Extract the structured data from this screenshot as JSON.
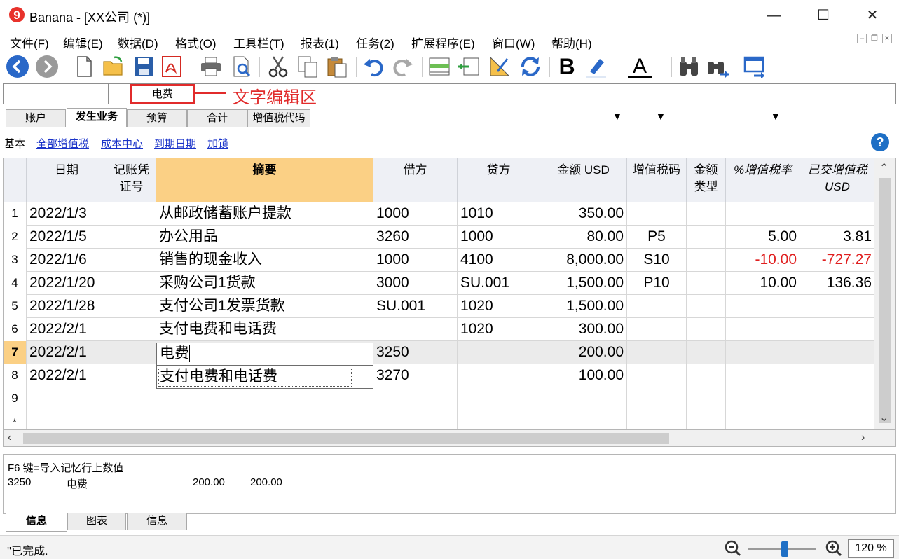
{
  "window": {
    "title": "Banana - [XX公司 (*)]"
  },
  "menu": [
    "文件(F)",
    "编辑(E)",
    "数据(D)",
    "格式(O)",
    "工具栏(T)",
    "报表(1)",
    "任务(2)",
    "扩展程序(E)",
    "窗口(W)",
    "帮助(H)"
  ],
  "toolbar": {
    "icons": [
      "back-icon",
      "forward-icon",
      "new-file-icon",
      "open-folder-icon",
      "save-icon",
      "pdf-icon",
      "print-icon",
      "print-preview-icon",
      "cut-icon",
      "copy-icon",
      "paste-icon",
      "undo-icon",
      "redo-icon",
      "insert-row-icon",
      "move-row-icon",
      "edit-tool-icon",
      "recalculate-icon",
      "bold-icon",
      "highlight-icon",
      "font-color-icon",
      "find-icon",
      "find-replace-icon",
      "window-icon"
    ],
    "bold_label": "B",
    "font_color_label": "A"
  },
  "editbar": {
    "value": "电费",
    "annotation": "文字编辑区"
  },
  "tabs": [
    "账户",
    "发生业务",
    "预算",
    "合计",
    "增值税代码"
  ],
  "active_tab": "发生业务",
  "views": {
    "base": "基本",
    "links": [
      "全部增值税",
      "成本中心",
      "到期日期",
      "加锁"
    ]
  },
  "help": "?",
  "columns": [
    "日期",
    "记账凭证号",
    "摘要",
    "借方",
    "贷方",
    "金额 USD",
    "增值税码",
    "金额类型",
    "%增值税率",
    "已交增值税 USD"
  ],
  "column_header_lines": {
    "voucher": [
      "记账凭",
      "证号"
    ],
    "amount_type": [
      "金额",
      "类型"
    ],
    "vat_paid": [
      "已交增值税",
      "USD"
    ]
  },
  "rows": [
    {
      "n": "1",
      "date": "2022/1/3",
      "doc": "",
      "desc": "从邮政储蓄账户提款",
      "debit": "1000",
      "credit": "1010",
      "amount": "350.00",
      "vat": "",
      "type": "",
      "rate": "",
      "paid": ""
    },
    {
      "n": "2",
      "date": "2022/1/5",
      "doc": "",
      "desc": "办公用品",
      "debit": "3260",
      "credit": "1000",
      "amount": "80.00",
      "vat": "P5",
      "type": "",
      "rate": "5.00",
      "paid": "3.81"
    },
    {
      "n": "3",
      "date": "2022/1/6",
      "doc": "",
      "desc": "销售的现金收入",
      "debit": "1000",
      "credit": "4100",
      "amount": "8,000.00",
      "vat": "S10",
      "type": "",
      "rate": "-10.00",
      "paid": "-727.27"
    },
    {
      "n": "4",
      "date": "2022/1/20",
      "doc": "",
      "desc": "采购公司1货款",
      "debit": "3000",
      "credit": "SU.001",
      "amount": "1,500.00",
      "vat": "P10",
      "type": "",
      "rate": "10.00",
      "paid": "136.36"
    },
    {
      "n": "5",
      "date": "2022/1/28",
      "doc": "",
      "desc": "支付公司1发票货款",
      "debit": "SU.001",
      "credit": "1020",
      "amount": "1,500.00",
      "vat": "",
      "type": "",
      "rate": "",
      "paid": ""
    },
    {
      "n": "6",
      "date": "2022/2/1",
      "doc": "",
      "desc": "支付电费和电话费",
      "debit": "",
      "credit": "1020",
      "amount": "300.00",
      "vat": "",
      "type": "",
      "rate": "",
      "paid": ""
    },
    {
      "n": "7",
      "date": "2022/2/1",
      "doc": "",
      "desc": "电费",
      "debit": "3250",
      "credit": "",
      "amount": "200.00",
      "vat": "",
      "type": "",
      "rate": "",
      "paid": ""
    },
    {
      "n": "8",
      "date": "2022/2/1",
      "doc": "",
      "desc": "支付电费和电话费",
      "debit": "3270",
      "credit": "",
      "amount": "100.00",
      "vat": "",
      "type": "",
      "rate": "",
      "paid": ""
    },
    {
      "n": "9",
      "date": "",
      "doc": "",
      "desc": "",
      "debit": "",
      "credit": "",
      "amount": "",
      "vat": "",
      "type": "",
      "rate": "",
      "paid": ""
    },
    {
      "n": "*",
      "date": "",
      "doc": "",
      "desc": "",
      "debit": "",
      "credit": "",
      "amount": "",
      "vat": "",
      "type": "",
      "rate": "",
      "paid": ""
    }
  ],
  "colors": {
    "accent": "#fbd085",
    "negative": "#e02020",
    "link": "#1a33c9",
    "annotation": "#e12b2b"
  },
  "info": {
    "hint": "F6 键=导入记忆行上数值",
    "line": {
      "account": "3250",
      "desc": "电费",
      "amount1": "200.00",
      "amount2": "200.00"
    }
  },
  "bottom_tabs": [
    "信息",
    "图表",
    "信息"
  ],
  "status": {
    "text": "''已完成.",
    "zoom": "120 %"
  }
}
